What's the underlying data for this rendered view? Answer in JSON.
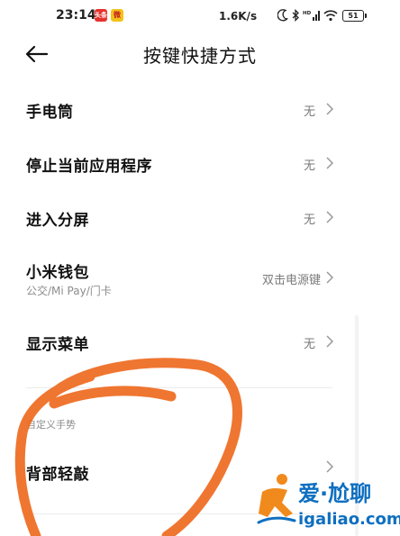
{
  "status_bar": {
    "time": "23:14",
    "app_badge_1": "头条",
    "app_badge_2": "微",
    "network_speed": "1.6K/s",
    "signal_label": "HD",
    "battery": "51"
  },
  "header": {
    "title": "按键快捷方式"
  },
  "rows": [
    {
      "title": "手电筒",
      "value": "无"
    },
    {
      "title": "停止当前应用程序",
      "value": "无"
    },
    {
      "title": "进入分屏",
      "value": "无"
    },
    {
      "title": "小米钱包",
      "subtitle": "公交/Mi Pay/门卡",
      "value": "双击电源键"
    },
    {
      "title": "显示菜单",
      "value": "无"
    }
  ],
  "section": {
    "label": "自定义手势"
  },
  "gesture_rows": [
    {
      "title": "背部轻敲",
      "value": ""
    }
  ],
  "watermark": {
    "main": "爱·尬聊",
    "domain": "igaliao.com"
  },
  "colors": {
    "scribble": "#ee6a1f",
    "watermark": "#0e6fc0"
  }
}
